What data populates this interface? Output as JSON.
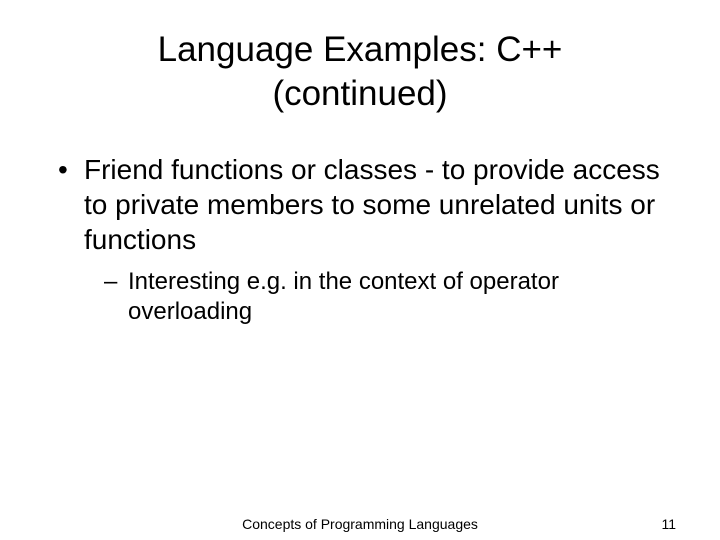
{
  "title_line1": "Language Examples: C++",
  "title_line2": "(continued)",
  "bullets": {
    "b1": "Friend functions or classes - to provide access to private members to some unrelated units or functions",
    "b1_sub1": "Interesting e.g. in the context of operator overloading"
  },
  "footer": {
    "center": "Concepts of Programming Languages",
    "page": "11"
  }
}
